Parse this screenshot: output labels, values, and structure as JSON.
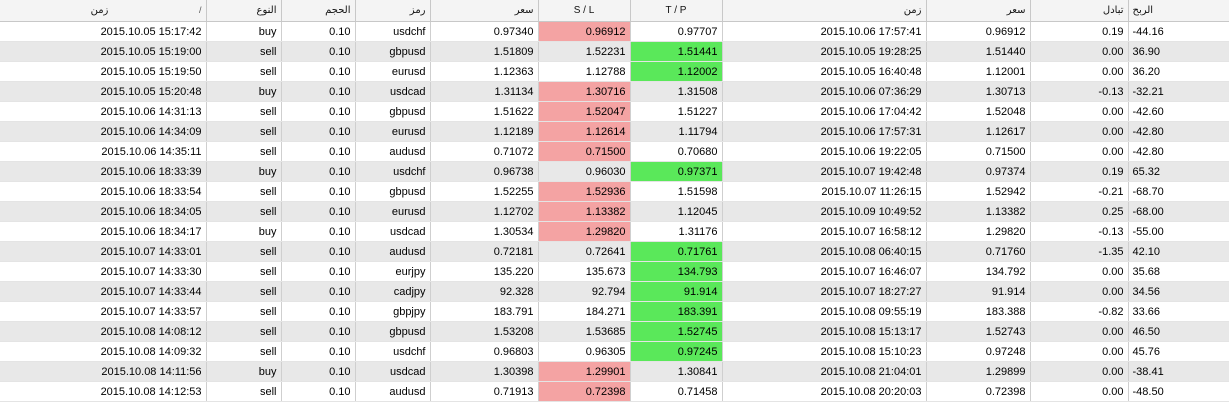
{
  "headers": {
    "time_open": "زمن",
    "sort_icon": "/",
    "type": "النوع",
    "volume": "الحجم",
    "symbol": "رمز",
    "open_price": "سعر",
    "sl": "S / L",
    "tp": "T / P",
    "time_close": "زمن",
    "close_price": "سعر",
    "swap": "تبادل",
    "profit": "الربح"
  },
  "rows": [
    {
      "time_open": "2015.10.05 15:17:42",
      "type": "buy",
      "volume": "0.10",
      "symbol": "usdchf",
      "open_price": "0.97340",
      "sl": "0.96912",
      "tp": "0.97707",
      "time_close": "2015.10.06 17:57:41",
      "close_price": "0.96912",
      "swap": "0.19",
      "profit": "-44.16",
      "hit": "sl"
    },
    {
      "time_open": "2015.10.05 15:19:00",
      "type": "sell",
      "volume": "0.10",
      "symbol": "gbpusd",
      "open_price": "1.51809",
      "sl": "1.52231",
      "tp": "1.51441",
      "time_close": "2015.10.05 19:28:25",
      "close_price": "1.51440",
      "swap": "0.00",
      "profit": "36.90",
      "hit": "tp"
    },
    {
      "time_open": "2015.10.05 15:19:50",
      "type": "sell",
      "volume": "0.10",
      "symbol": "eurusd",
      "open_price": "1.12363",
      "sl": "1.12788",
      "tp": "1.12002",
      "time_close": "2015.10.05 16:40:48",
      "close_price": "1.12001",
      "swap": "0.00",
      "profit": "36.20",
      "hit": "tp"
    },
    {
      "time_open": "2015.10.05 15:20:48",
      "type": "buy",
      "volume": "0.10",
      "symbol": "usdcad",
      "open_price": "1.31134",
      "sl": "1.30716",
      "tp": "1.31508",
      "time_close": "2015.10.06 07:36:29",
      "close_price": "1.30713",
      "swap": "-0.13",
      "profit": "-32.21",
      "hit": "sl"
    },
    {
      "time_open": "2015.10.06 14:31:13",
      "type": "sell",
      "volume": "0.10",
      "symbol": "gbpusd",
      "open_price": "1.51622",
      "sl": "1.52047",
      "tp": "1.51227",
      "time_close": "2015.10.06 17:04:42",
      "close_price": "1.52048",
      "swap": "0.00",
      "profit": "-42.60",
      "hit": "sl"
    },
    {
      "time_open": "2015.10.06 14:34:09",
      "type": "sell",
      "volume": "0.10",
      "symbol": "eurusd",
      "open_price": "1.12189",
      "sl": "1.12614",
      "tp": "1.11794",
      "time_close": "2015.10.06 17:57:31",
      "close_price": "1.12617",
      "swap": "0.00",
      "profit": "-42.80",
      "hit": "sl"
    },
    {
      "time_open": "2015.10.06 14:35:11",
      "type": "sell",
      "volume": "0.10",
      "symbol": "audusd",
      "open_price": "0.71072",
      "sl": "0.71500",
      "tp": "0.70680",
      "time_close": "2015.10.06 19:22:05",
      "close_price": "0.71500",
      "swap": "0.00",
      "profit": "-42.80",
      "hit": "sl"
    },
    {
      "time_open": "2015.10.06 18:33:39",
      "type": "buy",
      "volume": "0.10",
      "symbol": "usdchf",
      "open_price": "0.96738",
      "sl": "0.96030",
      "tp": "0.97371",
      "time_close": "2015.10.07 19:42:48",
      "close_price": "0.97374",
      "swap": "0.19",
      "profit": "65.32",
      "hit": "tp"
    },
    {
      "time_open": "2015.10.06 18:33:54",
      "type": "sell",
      "volume": "0.10",
      "symbol": "gbpusd",
      "open_price": "1.52255",
      "sl": "1.52936",
      "tp": "1.51598",
      "time_close": "2015.10.07 11:26:15",
      "close_price": "1.52942",
      "swap": "-0.21",
      "profit": "-68.70",
      "hit": "sl"
    },
    {
      "time_open": "2015.10.06 18:34:05",
      "type": "sell",
      "volume": "0.10",
      "symbol": "eurusd",
      "open_price": "1.12702",
      "sl": "1.13382",
      "tp": "1.12045",
      "time_close": "2015.10.09 10:49:52",
      "close_price": "1.13382",
      "swap": "0.25",
      "profit": "-68.00",
      "hit": "sl"
    },
    {
      "time_open": "2015.10.06 18:34:17",
      "type": "buy",
      "volume": "0.10",
      "symbol": "usdcad",
      "open_price": "1.30534",
      "sl": "1.29820",
      "tp": "1.31176",
      "time_close": "2015.10.07 16:58:12",
      "close_price": "1.29820",
      "swap": "-0.13",
      "profit": "-55.00",
      "hit": "sl"
    },
    {
      "time_open": "2015.10.07 14:33:01",
      "type": "sell",
      "volume": "0.10",
      "symbol": "audusd",
      "open_price": "0.72181",
      "sl": "0.72641",
      "tp": "0.71761",
      "time_close": "2015.10.08 06:40:15",
      "close_price": "0.71760",
      "swap": "-1.35",
      "profit": "42.10",
      "hit": "tp"
    },
    {
      "time_open": "2015.10.07 14:33:30",
      "type": "sell",
      "volume": "0.10",
      "symbol": "eurjpy",
      "open_price": "135.220",
      "sl": "135.673",
      "tp": "134.793",
      "time_close": "2015.10.07 16:46:07",
      "close_price": "134.792",
      "swap": "0.00",
      "profit": "35.68",
      "hit": "tp"
    },
    {
      "time_open": "2015.10.07 14:33:44",
      "type": "sell",
      "volume": "0.10",
      "symbol": "cadjpy",
      "open_price": "92.328",
      "sl": "92.794",
      "tp": "91.914",
      "time_close": "2015.10.07 18:27:27",
      "close_price": "91.914",
      "swap": "0.00",
      "profit": "34.56",
      "hit": "tp"
    },
    {
      "time_open": "2015.10.07 14:33:57",
      "type": "sell",
      "volume": "0.10",
      "symbol": "gbpjpy",
      "open_price": "183.791",
      "sl": "184.271",
      "tp": "183.391",
      "time_close": "2015.10.08 09:55:19",
      "close_price": "183.388",
      "swap": "-0.82",
      "profit": "33.66",
      "hit": "tp"
    },
    {
      "time_open": "2015.10.08 14:08:12",
      "type": "sell",
      "volume": "0.10",
      "symbol": "gbpusd",
      "open_price": "1.53208",
      "sl": "1.53685",
      "tp": "1.52745",
      "time_close": "2015.10.08 15:13:17",
      "close_price": "1.52743",
      "swap": "0.00",
      "profit": "46.50",
      "hit": "tp"
    },
    {
      "time_open": "2015.10.08 14:09:32",
      "type": "sell",
      "volume": "0.10",
      "symbol": "usdchf",
      "open_price": "0.96803",
      "sl": "0.96305",
      "tp": "0.97245",
      "time_close": "2015.10.08 15:10:23",
      "close_price": "0.97248",
      "swap": "0.00",
      "profit": "45.76",
      "hit": "tp"
    },
    {
      "time_open": "2015.10.08 14:11:56",
      "type": "buy",
      "volume": "0.10",
      "symbol": "usdcad",
      "open_price": "1.30398",
      "sl": "1.29901",
      "tp": "1.30841",
      "time_close": "2015.10.08 21:04:01",
      "close_price": "1.29899",
      "swap": "0.00",
      "profit": "-38.41",
      "hit": "sl"
    },
    {
      "time_open": "2015.10.08 14:12:53",
      "type": "sell",
      "volume": "0.10",
      "symbol": "audusd",
      "open_price": "0.71913",
      "sl": "0.72398",
      "tp": "0.71458",
      "time_close": "2015.10.08 20:20:03",
      "close_price": "0.72398",
      "swap": "0.00",
      "profit": "-48.50",
      "hit": "sl"
    }
  ],
  "colors": {
    "sl_hit": "#f4a3a3",
    "tp_hit": "#5ae85a",
    "row_alt": "#e8e8e8",
    "header_bg": "#f4f4f4"
  }
}
